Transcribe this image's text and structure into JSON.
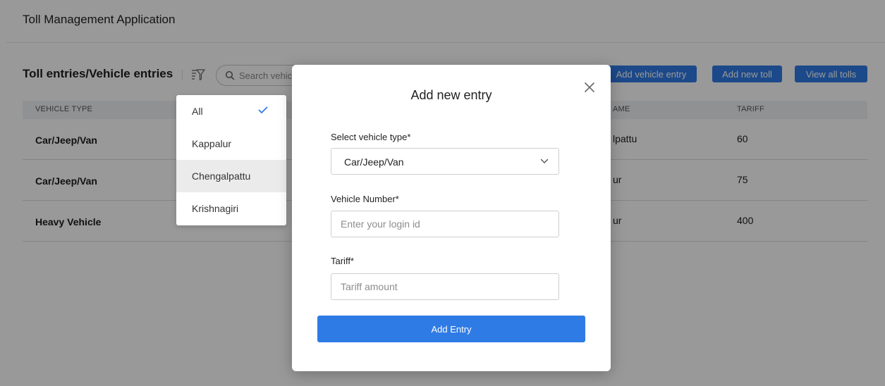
{
  "app": {
    "title": "Toll Management Application"
  },
  "toolbar": {
    "title": "Toll entries/Vehicle entries",
    "search_placeholder": "Search vehicle",
    "buttons": {
      "add_vehicle_entry": "Add vehicle entry",
      "add_new_toll": "Add new toll",
      "view_all_tolls": "View all tolls"
    }
  },
  "table": {
    "columns": [
      "VEHICLE TYPE",
      "AME",
      "TARIFF"
    ],
    "rows": [
      {
        "vehicle_type": "Car/Jeep/Van",
        "toll_name": "lpattu",
        "tariff": "60"
      },
      {
        "vehicle_type": "Car/Jeep/Van",
        "toll_name": "ur",
        "tariff": "75"
      },
      {
        "vehicle_type": "Heavy Vehicle",
        "toll_name": "ur",
        "tariff": "400"
      }
    ]
  },
  "filter_dropdown": {
    "items": [
      "All",
      "Kappalur",
      "Chengalpattu",
      "Krishnagiri"
    ],
    "selected": "All",
    "hovered": "Chengalpattu"
  },
  "modal": {
    "title": "Add new entry",
    "vehicle_type_label": "Select vehicle type*",
    "vehicle_type_value": "Car/Jeep/Van",
    "vehicle_number_label": "Vehicle Number*",
    "vehicle_number_placeholder": "Enter your login id",
    "tariff_label": "Tariff*",
    "tariff_placeholder": "Tariff amount",
    "submit_label": "Add Entry"
  },
  "colors": {
    "accent": "#2f7be5",
    "overlay": "rgba(0,0,0,0.40)",
    "table_header_bg": "#f1f2f4"
  },
  "icons": {
    "filter": "filter-icon",
    "search": "search-icon",
    "close": "close-icon",
    "chevron": "chevron-down-icon",
    "check": "check-icon"
  }
}
